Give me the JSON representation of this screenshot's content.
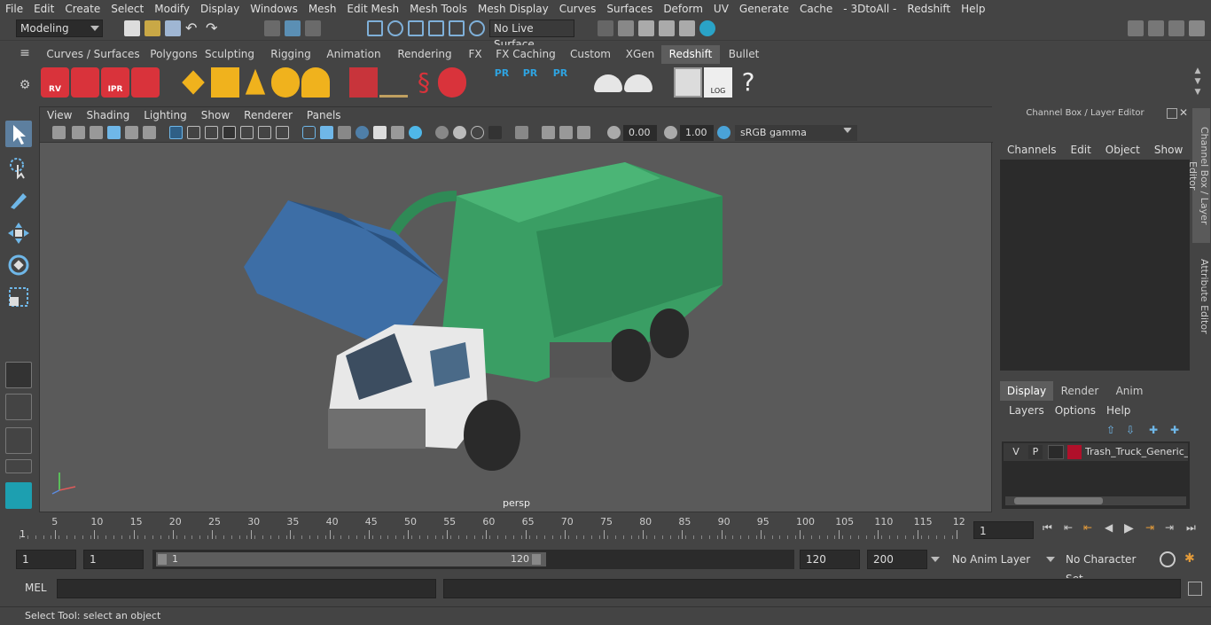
{
  "menubar": [
    "File",
    "Edit",
    "Create",
    "Select",
    "Modify",
    "Display",
    "Windows",
    "Mesh",
    "Edit Mesh",
    "Mesh Tools",
    "Mesh Display",
    "Curves",
    "Surfaces",
    "Deform",
    "UV",
    "Generate",
    "Cache",
    "- 3DtoAll -",
    "Redshift",
    "Help"
  ],
  "statusline": {
    "mode": "Modeling",
    "live_surface": "No Live Surface"
  },
  "shelf_tabs": [
    "Curves / Surfaces",
    "Polygons",
    "Sculpting",
    "Rigging",
    "Animation",
    "Rendering",
    "FX",
    "FX Caching",
    "Custom",
    "XGen",
    "Redshift",
    "Bullet"
  ],
  "active_shelf_tab": "Redshift",
  "shelf_labels": {
    "rv": "RV",
    "ipr": "IPR",
    "pr": "PR",
    "log": "LOG",
    "help": "?"
  },
  "viewport": {
    "menu": [
      "View",
      "Shading",
      "Lighting",
      "Show",
      "Renderer",
      "Panels"
    ],
    "exposure": "0.00",
    "gamma": "1.00",
    "colorspace": "sRGB gamma",
    "camera": "persp"
  },
  "channel_box": {
    "title": "Channel Box / Layer Editor",
    "menu": [
      "Channels",
      "Edit",
      "Object",
      "Show"
    ]
  },
  "layer_editor": {
    "tabs": [
      "Display",
      "Render",
      "Anim"
    ],
    "active_tab": "Display",
    "menu": [
      "Layers",
      "Options",
      "Help"
    ],
    "layer": {
      "v": "V",
      "p": "P",
      "name": "Trash_Truck_Generic_w",
      "color": "#b0102a"
    }
  },
  "side_tabs": [
    "Channel Box / Layer Editor",
    "Attribute Editor"
  ],
  "timeline": {
    "ticks": [
      "5",
      "10",
      "15",
      "20",
      "25",
      "30",
      "35",
      "40",
      "45",
      "50",
      "55",
      "60",
      "65",
      "70",
      "75",
      "80",
      "85",
      "90",
      "95",
      "100",
      "105",
      "110",
      "115",
      "12"
    ],
    "start_marker": "1",
    "current_frame": "1"
  },
  "range": {
    "start": "1",
    "playback_start": "1",
    "slider_start": "1",
    "slider_end": "120",
    "playback_end": "120",
    "end": "200",
    "anim_layer": "No Anim Layer",
    "character_set": "No Character Set"
  },
  "command": {
    "lang": "MEL"
  },
  "help_text": "Select Tool: select an object"
}
